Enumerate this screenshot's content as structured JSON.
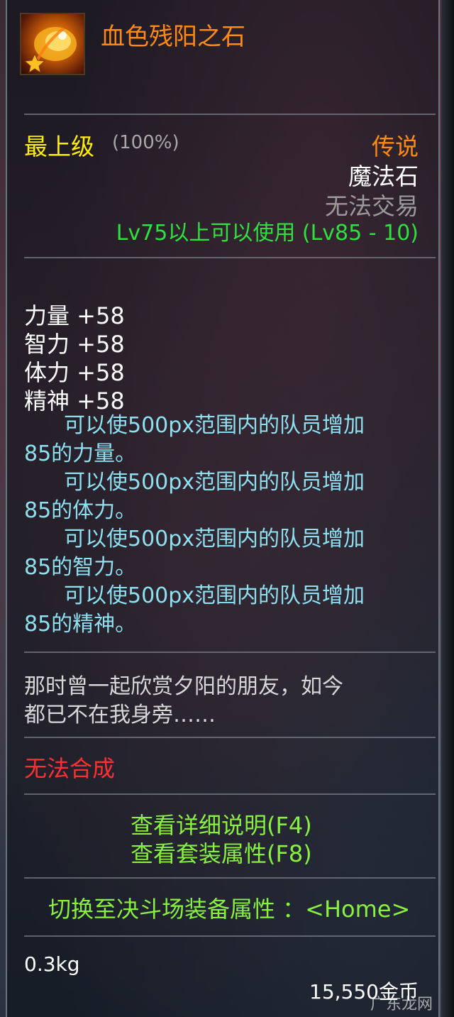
{
  "item": {
    "name": "血色残阳之石",
    "grade": "最上级",
    "grade_percent": "(100%)",
    "rarity": "传说",
    "type": "魔法石",
    "trade": "无法交易",
    "level_req": "Lv75以上可以使用 (Lv85 - 10)",
    "stats": [
      {
        "label": "力量 +58"
      },
      {
        "label": "智力 +58"
      },
      {
        "label": "体力 +58"
      },
      {
        "label": "精神 +58"
      }
    ],
    "effects": [
      {
        "line1": "可以使500px范围内的队员增加",
        "line2": "85的力量。"
      },
      {
        "line1": "可以使500px范围内的队员增加",
        "line2": "85的体力。"
      },
      {
        "line1": "可以使500px范围内的队员增加",
        "line2": "85的智力。"
      },
      {
        "line1": "可以使500px范围内的队员增加",
        "line2": "85的精神。"
      }
    ],
    "flavor_line1": "那时曾一起欣赏夕阳的朋友，如今",
    "flavor_line2": "都已不在我身旁……",
    "craft_status": "无法合成",
    "link_detail": "查看详细说明(F4)",
    "link_set": "查看套装属性(F8)",
    "link_pvp": "切换至决斗场装备属性 ：<Home>",
    "weight": "0.3kg",
    "price": "15,550金币"
  },
  "watermark": "广东龙网",
  "colors": {
    "name": "#ff8a18",
    "grade": "#ffee00",
    "level": "#30e040",
    "effect": "#8ee0f0",
    "no_craft": "#ff3030",
    "link": "#88f040"
  },
  "icons": {
    "item_icon": "flaming-stone-icon",
    "star_badge": "star-icon"
  }
}
